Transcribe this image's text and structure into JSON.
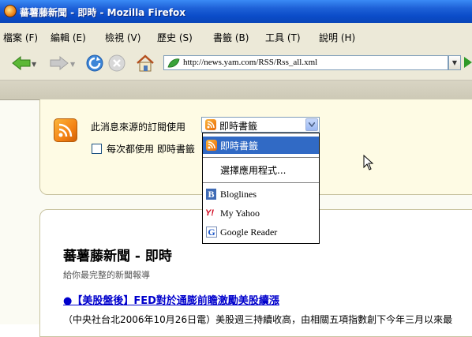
{
  "window": {
    "title": "蕃薯藤新聞 - 即時 - Mozilla Firefox"
  },
  "menu": [
    "檔案 (F)",
    "編輯 (E)",
    "檢視 (V)",
    "歷史 (S)",
    "書籤 (B)",
    "工具 (T)",
    "說明 (H)"
  ],
  "navbar": {
    "url": "http://news.yam.com/RSS/Rss_all.xml"
  },
  "subscribe": {
    "label": "此消息來源的訂閱使用",
    "selected": "即時書籤",
    "always_label": "每次都使用 即時書籤"
  },
  "dropdown": {
    "options": [
      {
        "label": "即時書籤",
        "icon": "rss-icon",
        "selected": true
      },
      {
        "label": "選擇應用程式...",
        "icon": "",
        "selected": false
      },
      {
        "label": "Bloglines",
        "icon": "bloglines-icon",
        "selected": false
      },
      {
        "label": "My Yahoo",
        "icon": "yahoo-icon",
        "selected": false
      },
      {
        "label": "Google Reader",
        "icon": "google-icon",
        "selected": false
      }
    ]
  },
  "feed": {
    "title": "蕃薯藤新聞 - 即時",
    "subtitle": "給你最完整的新聞報導",
    "item_link": "●【美股盤後】FED對於通膨前瞻激勵美股續漲",
    "item_body": "（中央社台北2006年10月26日電）美股週三持續收高，由相關五項指數創下今年三月以來最"
  },
  "colors": {
    "title_bar": "#0b4cc9",
    "selected_option": "#316ac5",
    "link": "#0000cc",
    "panel": "#fefbe4"
  }
}
